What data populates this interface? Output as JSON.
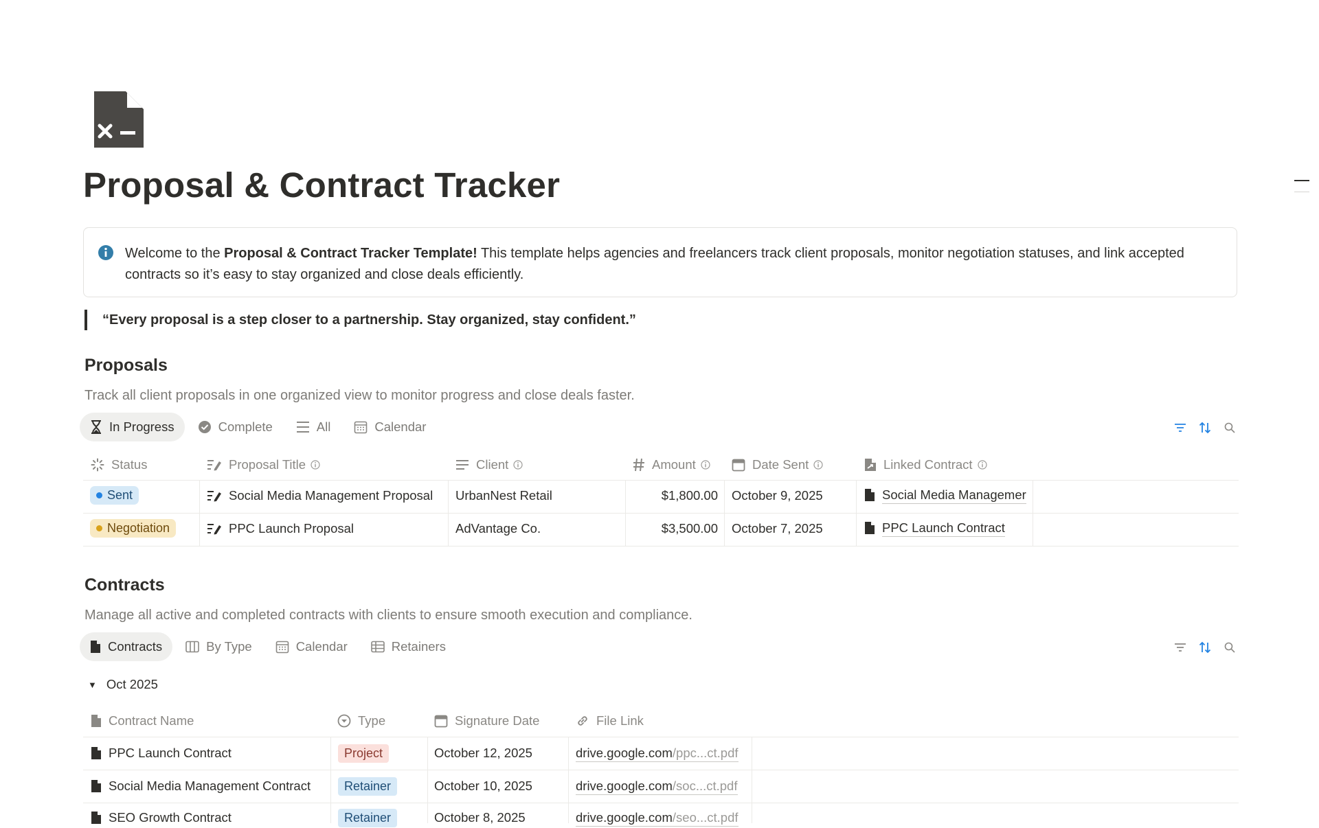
{
  "page": {
    "icon": "document-icon",
    "title": "Proposal & Contract Tracker",
    "toc_icon": "table-of-contents-icon"
  },
  "callout": {
    "icon": "info-icon",
    "text_before": "Welcome to the ",
    "text_bold": "Proposal & Contract Tracker Template!",
    "text_after": " This template helps agencies and freelancers track client proposals, monitor negotiation statuses, and link accepted contracts so it’s easy to stay organized and close deals efficiently."
  },
  "quote": "“Every proposal is a step closer to a partnership. Stay organized, stay confident.”",
  "proposals": {
    "title": "Proposals",
    "description": "Track all client proposals in one organized view to monitor progress and close deals faster.",
    "tabs": [
      {
        "label": "In Progress",
        "icon": "hourglass-icon",
        "active": true
      },
      {
        "label": "Complete",
        "icon": "check-circle-icon",
        "active": false
      },
      {
        "label": "All",
        "icon": "list-icon",
        "active": false
      },
      {
        "label": "Calendar",
        "icon": "calendar-icon",
        "active": false
      }
    ],
    "tools": [
      "filter-icon",
      "sort-icon",
      "search-icon"
    ],
    "columns": [
      "Status",
      "Proposal Title",
      "Client",
      "Amount",
      "Date Sent",
      "Linked Contract"
    ],
    "rows": [
      {
        "status": "Sent",
        "status_color": "#2383e2",
        "title": "Social Media Management Proposal",
        "client": "UrbanNest Retail",
        "amount": "$1,800.00",
        "date_sent": "October 9, 2025",
        "linked_contract": "Social Media Managemer"
      },
      {
        "status": "Negotiation",
        "status_color": "#d9a21b",
        "title": "PPC Launch Proposal",
        "client": "AdVantage Co.",
        "amount": "$3,500.00",
        "date_sent": "October 7, 2025",
        "linked_contract": "PPC Launch Contract"
      }
    ]
  },
  "contracts": {
    "title": "Contracts",
    "description": "Manage all active and completed contracts with clients to ensure smooth execution and compliance.",
    "tabs": [
      {
        "label": "Contracts",
        "icon": "document-icon",
        "active": true
      },
      {
        "label": "By Type",
        "icon": "board-icon",
        "active": false
      },
      {
        "label": "Calendar",
        "icon": "calendar-icon",
        "active": false
      },
      {
        "label": "Retainers",
        "icon": "table-icon",
        "active": false
      }
    ],
    "tools": [
      "filter-icon",
      "sort-icon",
      "search-icon"
    ],
    "group_label": "Oct 2025",
    "columns": [
      "Contract Name",
      "Type",
      "Signature Date",
      "File Link"
    ],
    "rows": [
      {
        "name": "PPC Launch Contract",
        "type": "Project",
        "signature_date": "October 12, 2025",
        "link_domain": "drive.google.com",
        "link_path": "/ppc...ct.pdf"
      },
      {
        "name": "Social Media Management Contract",
        "type": "Retainer",
        "signature_date": "October 10, 2025",
        "link_domain": "drive.google.com",
        "link_path": "/soc...ct.pdf"
      },
      {
        "name": "SEO Growth Contract",
        "type": "Retainer",
        "signature_date": "October 8, 2025",
        "link_domain": "drive.google.com",
        "link_path": "/seo...ct.pdf"
      }
    ]
  }
}
